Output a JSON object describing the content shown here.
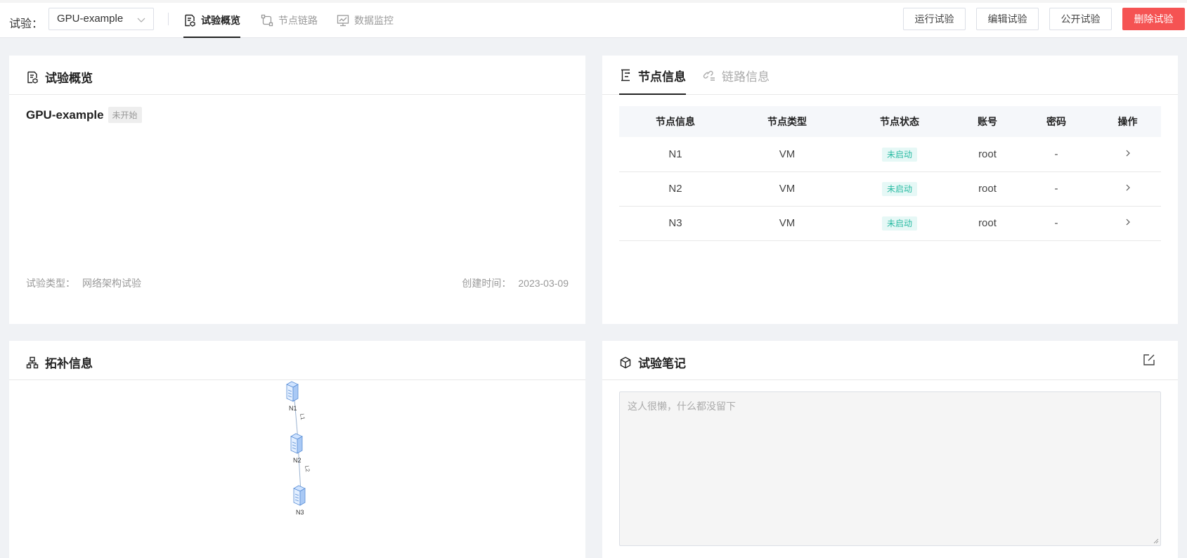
{
  "header": {
    "experiment_label": "试验：",
    "experiment_select_value": "GPU-example",
    "tabs": [
      {
        "label": "试验概览",
        "icon": "overview-doc-icon",
        "active": true
      },
      {
        "label": "节点链路",
        "icon": "node-link-icon",
        "active": false
      },
      {
        "label": "数据监控",
        "icon": "monitor-icon",
        "active": false
      }
    ],
    "actions": {
      "run": "运行试验",
      "edit": "编辑试验",
      "publish": "公开试验",
      "delete": "删除试验"
    }
  },
  "overview": {
    "title": "试验概览",
    "name": "GPU-example",
    "status": "未开始",
    "type_label": "试验类型：",
    "type_value": "网络架构试验",
    "created_label": "创建时间：",
    "created_value": "2023-03-09"
  },
  "node_panel": {
    "tabs": [
      "节点信息",
      "链路信息"
    ],
    "columns": [
      "节点信息",
      "节点类型",
      "节点状态",
      "账号",
      "密码",
      "操作"
    ],
    "rows": [
      {
        "name": "N1",
        "type": "VM",
        "status": "未启动",
        "account": "root",
        "password": "-"
      },
      {
        "name": "N2",
        "type": "VM",
        "status": "未启动",
        "account": "root",
        "password": "-"
      },
      {
        "name": "N3",
        "type": "VM",
        "status": "未启动",
        "account": "root",
        "password": "-"
      }
    ]
  },
  "topology": {
    "title": "拓补信息",
    "nodes": [
      "N1",
      "N2",
      "N3"
    ],
    "links": [
      "L1",
      "L2"
    ]
  },
  "notes": {
    "title": "试验笔记",
    "placeholder": "这人很懒，什么都没留下"
  },
  "colors": {
    "danger": "#f55353",
    "status_text": "#2abba3",
    "status_bg": "#e6f8f6",
    "page_bg": "#f0f2f5"
  }
}
